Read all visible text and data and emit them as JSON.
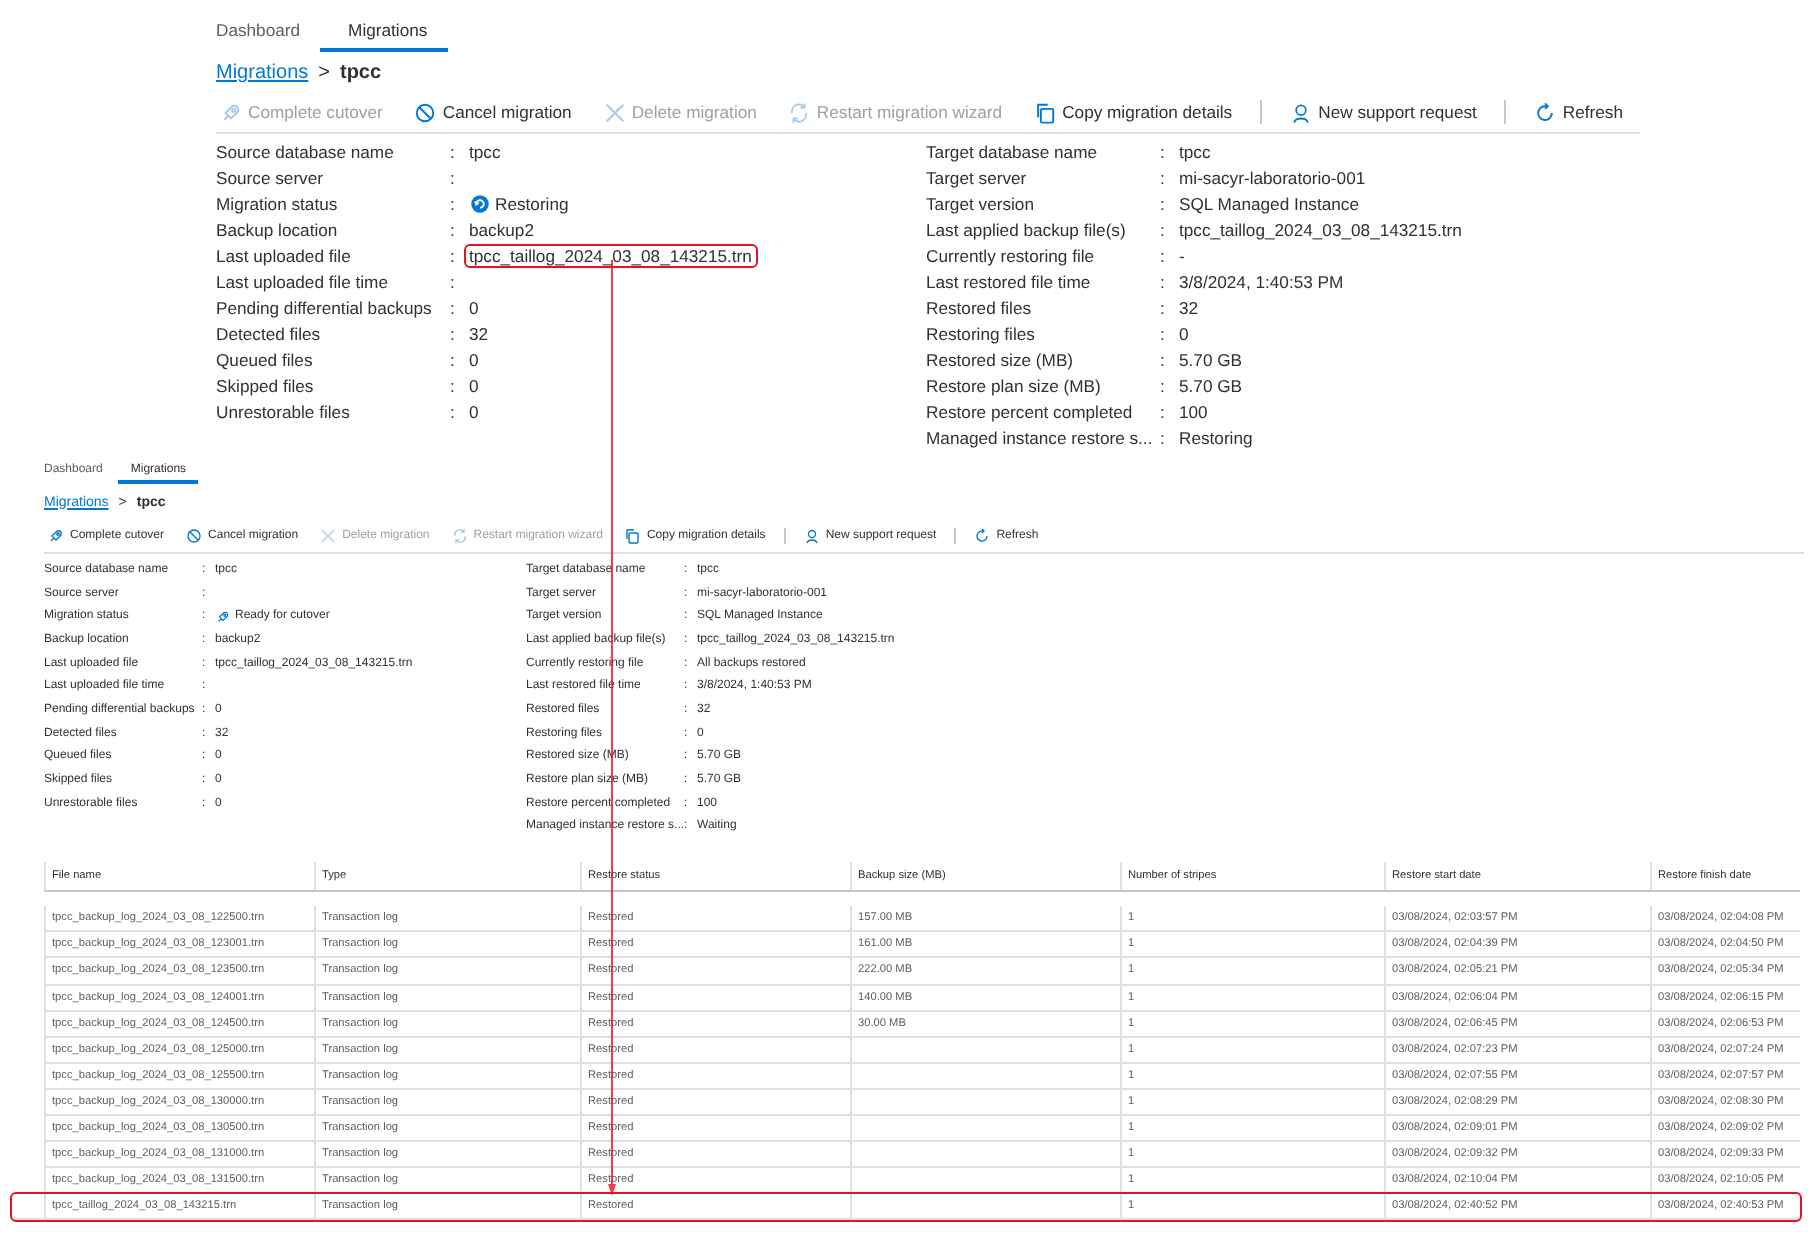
{
  "panels": [
    {
      "tabs": [
        {
          "label": "Dashboard",
          "selected": false
        },
        {
          "label": "Migrations",
          "selected": true
        }
      ],
      "breadcrumb": {
        "link": "Migrations",
        "separator": ">",
        "current": "tpcc"
      },
      "toolbar": [
        {
          "label": "Complete cutover",
          "disabled": true
        },
        {
          "label": "Cancel migration",
          "disabled": false
        },
        {
          "label": "Delete migration",
          "disabled": true
        },
        {
          "label": "Restart migration wizard",
          "disabled": true
        },
        {
          "label": "Copy migration details",
          "disabled": false
        },
        {
          "label": "New support request",
          "disabled": false
        },
        {
          "label": "Refresh",
          "disabled": false
        }
      ],
      "source_fields": [
        {
          "label": "Source database name",
          "colon": ":",
          "value": "tpcc",
          "kind": "text",
          "highlighted": false
        },
        {
          "label": "Source server",
          "colon": ":",
          "highlighted": false
        },
        {
          "label": "Migration status",
          "colon": ":",
          "value": "Restoring",
          "kind": "status",
          "highlighted": false
        },
        {
          "label": "Backup location",
          "colon": ":",
          "value": "backup2",
          "kind": "text",
          "highlighted": false
        },
        {
          "label": "Last uploaded file",
          "colon": ":",
          "value": "tpcc_taillog_2024_03_08_143215.trn",
          "kind": "text",
          "highlighted": true
        },
        {
          "label": "Last uploaded file time",
          "colon": ":",
          "highlighted": false
        },
        {
          "label": "Pending differential backups",
          "colon": ":",
          "value": "0",
          "kind": "text",
          "highlighted": false
        },
        {
          "label": "Detected files",
          "colon": ":",
          "value": "32",
          "kind": "text",
          "highlighted": false
        },
        {
          "label": "Queued files",
          "colon": ":",
          "value": "0",
          "kind": "text",
          "highlighted": false
        },
        {
          "label": "Skipped files",
          "colon": ":",
          "value": "0",
          "kind": "text",
          "highlighted": false
        },
        {
          "label": "Unrestorable files",
          "colon": ":",
          "value": "0",
          "kind": "text",
          "highlighted": false
        }
      ],
      "target_fields": [
        {
          "label": "Target database name",
          "colon": ":",
          "value": "tpcc",
          "kind": "text",
          "highlighted": false
        },
        {
          "label": "Target server",
          "colon": ":",
          "value": "mi-sacyr-laboratorio-001",
          "kind": "text",
          "highlighted": false
        },
        {
          "label": "Target version",
          "colon": ":",
          "value": "SQL Managed Instance",
          "kind": "text",
          "highlighted": false
        },
        {
          "label": "Last applied backup file(s)",
          "colon": ":",
          "value": "tpcc_taillog_2024_03_08_143215.trn",
          "kind": "text",
          "highlighted": false
        },
        {
          "label": "Currently restoring file",
          "colon": ":",
          "value": "-",
          "kind": "text",
          "highlighted": false
        },
        {
          "label": "Last restored file time",
          "colon": ":",
          "value": "3/8/2024, 1:40:53 PM",
          "kind": "text",
          "highlighted": false
        },
        {
          "label": "Restored files",
          "colon": ":",
          "value": "32",
          "kind": "text",
          "highlighted": false
        },
        {
          "label": "Restoring files",
          "colon": ":",
          "value": "0",
          "kind": "text",
          "highlighted": false
        },
        {
          "label": "Restored size (MB)",
          "colon": ":",
          "value": "5.70 GB",
          "kind": "text",
          "highlighted": false
        },
        {
          "label": "Restore plan size (MB)",
          "colon": ":",
          "value": "5.70 GB",
          "kind": "text",
          "highlighted": false
        },
        {
          "label": "Restore percent completed",
          "colon": ":",
          "value": "100",
          "kind": "text",
          "highlighted": false
        },
        {
          "label": "Managed instance restore s...",
          "colon": ":",
          "value": "Restoring",
          "kind": "text",
          "highlighted": false
        }
      ]
    },
    {
      "tabs": [
        {
          "label": "Dashboard",
          "selected": false
        },
        {
          "label": "Migrations",
          "selected": true
        }
      ],
      "breadcrumb": {
        "link": "Migrations",
        "separator": ">",
        "current": "tpcc"
      },
      "toolbar": [
        {
          "label": "Complete cutover",
          "disabled": false
        },
        {
          "label": "Cancel migration",
          "disabled": false
        },
        {
          "label": "Delete migration",
          "disabled": true
        },
        {
          "label": "Restart migration wizard",
          "disabled": true
        },
        {
          "label": "Copy migration details",
          "disabled": false
        },
        {
          "label": "New support request",
          "disabled": false
        },
        {
          "label": "Refresh",
          "disabled": false
        }
      ],
      "source_fields": [
        {
          "label": "Source database name",
          "colon": ":",
          "value": "tpcc",
          "kind": "text",
          "highlighted": false
        },
        {
          "label": "Source server",
          "colon": ":",
          "highlighted": false
        },
        {
          "label": "Migration status",
          "colon": ":",
          "value": "Ready for cutover",
          "kind": "status",
          "highlighted": false
        },
        {
          "label": "Backup location",
          "colon": ":",
          "value": "backup2",
          "kind": "text",
          "highlighted": false
        },
        {
          "label": "Last uploaded file",
          "colon": ":",
          "value": "tpcc_taillog_2024_03_08_143215.trn",
          "kind": "text",
          "highlighted": false
        },
        {
          "label": "Last uploaded file time",
          "colon": ":",
          "highlighted": false
        },
        {
          "label": "Pending differential backups",
          "colon": ":",
          "value": "0",
          "kind": "text",
          "highlighted": false
        },
        {
          "label": "Detected files",
          "colon": ":",
          "value": "32",
          "kind": "text",
          "highlighted": false
        },
        {
          "label": "Queued files",
          "colon": ":",
          "value": "0",
          "kind": "text",
          "highlighted": false
        },
        {
          "label": "Skipped files",
          "colon": ":",
          "value": "0",
          "kind": "text",
          "highlighted": false
        },
        {
          "label": "Unrestorable files",
          "colon": ":",
          "value": "0",
          "kind": "text",
          "highlighted": false
        }
      ],
      "target_fields": [
        {
          "label": "Target database name",
          "colon": ":",
          "value": "tpcc",
          "kind": "text",
          "highlighted": false
        },
        {
          "label": "Target server",
          "colon": ":",
          "value": "mi-sacyr-laboratorio-001",
          "kind": "text",
          "highlighted": false
        },
        {
          "label": "Target version",
          "colon": ":",
          "value": "SQL Managed Instance",
          "kind": "text",
          "highlighted": false
        },
        {
          "label": "Last applied backup file(s)",
          "colon": ":",
          "value": "tpcc_taillog_2024_03_08_143215.trn",
          "kind": "text",
          "highlighted": false
        },
        {
          "label": "Currently restoring file",
          "colon": ":",
          "value": "All backups restored",
          "kind": "text",
          "highlighted": false
        },
        {
          "label": "Last restored file time",
          "colon": ":",
          "value": "3/8/2024, 1:40:53 PM",
          "kind": "text",
          "highlighted": false
        },
        {
          "label": "Restored files",
          "colon": ":",
          "value": "32",
          "kind": "text",
          "highlighted": false
        },
        {
          "label": "Restoring files",
          "colon": ":",
          "value": "0",
          "kind": "text",
          "highlighted": false
        },
        {
          "label": "Restored size (MB)",
          "colon": ":",
          "value": "5.70 GB",
          "kind": "text",
          "highlighted": false
        },
        {
          "label": "Restore plan size (MB)",
          "colon": ":",
          "value": "5.70 GB",
          "kind": "text",
          "highlighted": false
        },
        {
          "label": "Restore percent completed",
          "colon": ":",
          "value": "100",
          "kind": "text",
          "highlighted": false
        },
        {
          "label": "Managed instance restore s...",
          "colon": ":",
          "value": "Waiting",
          "kind": "text",
          "highlighted": false
        }
      ]
    }
  ],
  "table": {
    "columns": [
      "File name",
      "Type",
      "Restore status",
      "Backup size (MB)",
      "Number of stripes",
      "Restore start date",
      "Restore finish date"
    ],
    "rows": [
      {
        "cells": [
          "tpcc_backup_log_2024_03_08_122500.trn",
          "Transaction log",
          "Restored",
          "157.00 MB",
          "1",
          "03/08/2024, 02:03:57 PM",
          "03/08/2024, 02:04:08 PM"
        ],
        "highlighted": false
      },
      {
        "cells": [
          "tpcc_backup_log_2024_03_08_123001.trn",
          "Transaction log",
          "Restored",
          "161.00 MB",
          "1",
          "03/08/2024, 02:04:39 PM",
          "03/08/2024, 02:04:50 PM"
        ],
        "highlighted": false
      },
      {
        "cells": [
          "tpcc_backup_log_2024_03_08_123500.trn",
          "Transaction log",
          "Restored",
          "222.00 MB",
          "1",
          "03/08/2024, 02:05:21 PM",
          "03/08/2024, 02:05:34 PM"
        ],
        "highlighted": false
      },
      {
        "cells": [
          "tpcc_backup_log_2024_03_08_124001.trn",
          "Transaction log",
          "Restored",
          "140.00 MB",
          "1",
          "03/08/2024, 02:06:04 PM",
          "03/08/2024, 02:06:15 PM"
        ],
        "highlighted": false
      },
      {
        "cells": [
          "tpcc_backup_log_2024_03_08_124500.trn",
          "Transaction log",
          "Restored",
          "30.00 MB",
          "1",
          "03/08/2024, 02:06:45 PM",
          "03/08/2024, 02:06:53 PM"
        ],
        "highlighted": false
      },
      {
        "cells": [
          "tpcc_backup_log_2024_03_08_125000.trn",
          "Transaction log",
          "Restored",
          "",
          "1",
          "03/08/2024, 02:07:23 PM",
          "03/08/2024, 02:07:24 PM"
        ],
        "highlighted": false
      },
      {
        "cells": [
          "tpcc_backup_log_2024_03_08_125500.trn",
          "Transaction log",
          "Restored",
          "",
          "1",
          "03/08/2024, 02:07:55 PM",
          "03/08/2024, 02:07:57 PM"
        ],
        "highlighted": false
      },
      {
        "cells": [
          "tpcc_backup_log_2024_03_08_130000.trn",
          "Transaction log",
          "Restored",
          "",
          "1",
          "03/08/2024, 02:08:29 PM",
          "03/08/2024, 02:08:30 PM"
        ],
        "highlighted": false
      },
      {
        "cells": [
          "tpcc_backup_log_2024_03_08_130500.trn",
          "Transaction log",
          "Restored",
          "",
          "1",
          "03/08/2024, 02:09:01 PM",
          "03/08/2024, 02:09:02 PM"
        ],
        "highlighted": false
      },
      {
        "cells": [
          "tpcc_backup_log_2024_03_08_131000.trn",
          "Transaction log",
          "Restored",
          "",
          "1",
          "03/08/2024, 02:09:32 PM",
          "03/08/2024, 02:09:33 PM"
        ],
        "highlighted": false
      },
      {
        "cells": [
          "tpcc_backup_log_2024_03_08_131500.trn",
          "Transaction log",
          "Restored",
          "",
          "1",
          "03/08/2024, 02:10:04 PM",
          "03/08/2024, 02:10:05 PM"
        ],
        "highlighted": false
      },
      {
        "cells": [
          "tpcc_taillog_2024_03_08_143215.trn",
          "Transaction log",
          "Restored",
          "",
          "1",
          "03/08/2024, 02:40:52 PM",
          "03/08/2024, 02:40:53 PM"
        ],
        "highlighted": true
      }
    ]
  }
}
